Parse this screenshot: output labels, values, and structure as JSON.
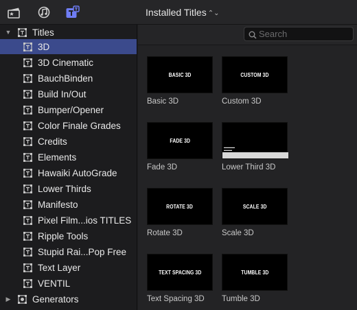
{
  "toolbar": {
    "icons": [
      "clapper-board-icon",
      "music-notes-icon",
      "titles-generators-icon"
    ],
    "title": "Installed Titles",
    "title_suffix": "⌃⌄",
    "accent_color": "#6f7df5"
  },
  "sidebar": {
    "titles_header": "Titles",
    "items": [
      "3D",
      "3D Cinematic",
      "BauchBinden",
      "Build In/Out",
      "Bumper/Opener",
      "Color Finale Grades",
      "Credits",
      "Elements",
      "Hawaiki AutoGrade",
      "Lower Thirds",
      "Manifesto",
      "Pixel Film...ios TITLES",
      "Ripple Tools",
      "Stupid Rai...Pop Free",
      "Text Layer",
      "VENTIL"
    ],
    "selected_item": "3D",
    "selection_color": "#3b4a8c",
    "generators_header": "Generators"
  },
  "browser": {
    "search_placeholder": "Search",
    "tiles": [
      {
        "thumb_text": "BASIC 3D",
        "label": "Basic 3D"
      },
      {
        "thumb_text": "CUSTOM 3D",
        "label": "Custom 3D"
      },
      {
        "thumb_text": "FADE 3D",
        "label": "Fade 3D"
      },
      {
        "thumb_text": "",
        "label": "Lower Third 3D"
      },
      {
        "thumb_text": "ROTATE 3D",
        "label": "Rotate 3D"
      },
      {
        "thumb_text": "SCALE 3D",
        "label": "Scale 3D"
      },
      {
        "thumb_text": "TEXT SPACING 3D",
        "label": "Text Spacing 3D"
      },
      {
        "thumb_text": "TUMBLE 3D",
        "label": "Tumble 3D"
      }
    ]
  }
}
